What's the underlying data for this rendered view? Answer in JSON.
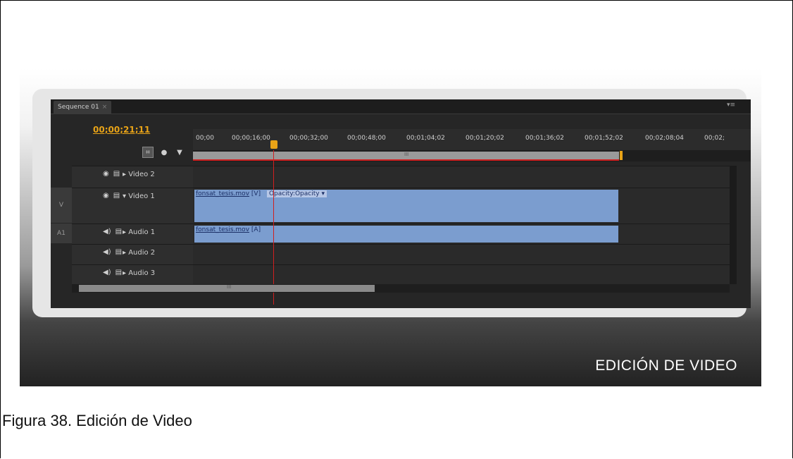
{
  "panel": {
    "tab_label": "Sequence 01",
    "tab_close": "×",
    "panel_menu": "▾≡",
    "timecode": "00;00;21;11"
  },
  "ruler": {
    "ticks": [
      "00;00",
      "00;00;16;00",
      "00;00;32;00",
      "00;00;48;00",
      "00;01;04;02",
      "00;01;20;02",
      "00;01;36;02",
      "00;01;52;02",
      "00;02;08;04",
      "00;02;"
    ]
  },
  "tracks": {
    "video2": {
      "label": "Video 2"
    },
    "video1": {
      "label": "Video 1",
      "source": "V"
    },
    "audio1": {
      "label": "Audio 1",
      "source": "A1"
    },
    "audio2": {
      "label": "Audio 2"
    },
    "audio3": {
      "label": "Audio 3"
    }
  },
  "clips": {
    "video_name": "fonsat_tesis.mov",
    "video_suffix": "[V]",
    "opacity_label": "Opacity:Opacity ▾",
    "audio_name": "fonsat_tesis.mov",
    "audio_suffix": "[A]"
  },
  "overlay_title": "EDICIÓN DE VIDEO",
  "figure_caption": "Figura 38. Edición de Video",
  "colors": {
    "timecode": "#e8a317",
    "playhead": "#d02020",
    "clip": "#7b9dcf"
  }
}
